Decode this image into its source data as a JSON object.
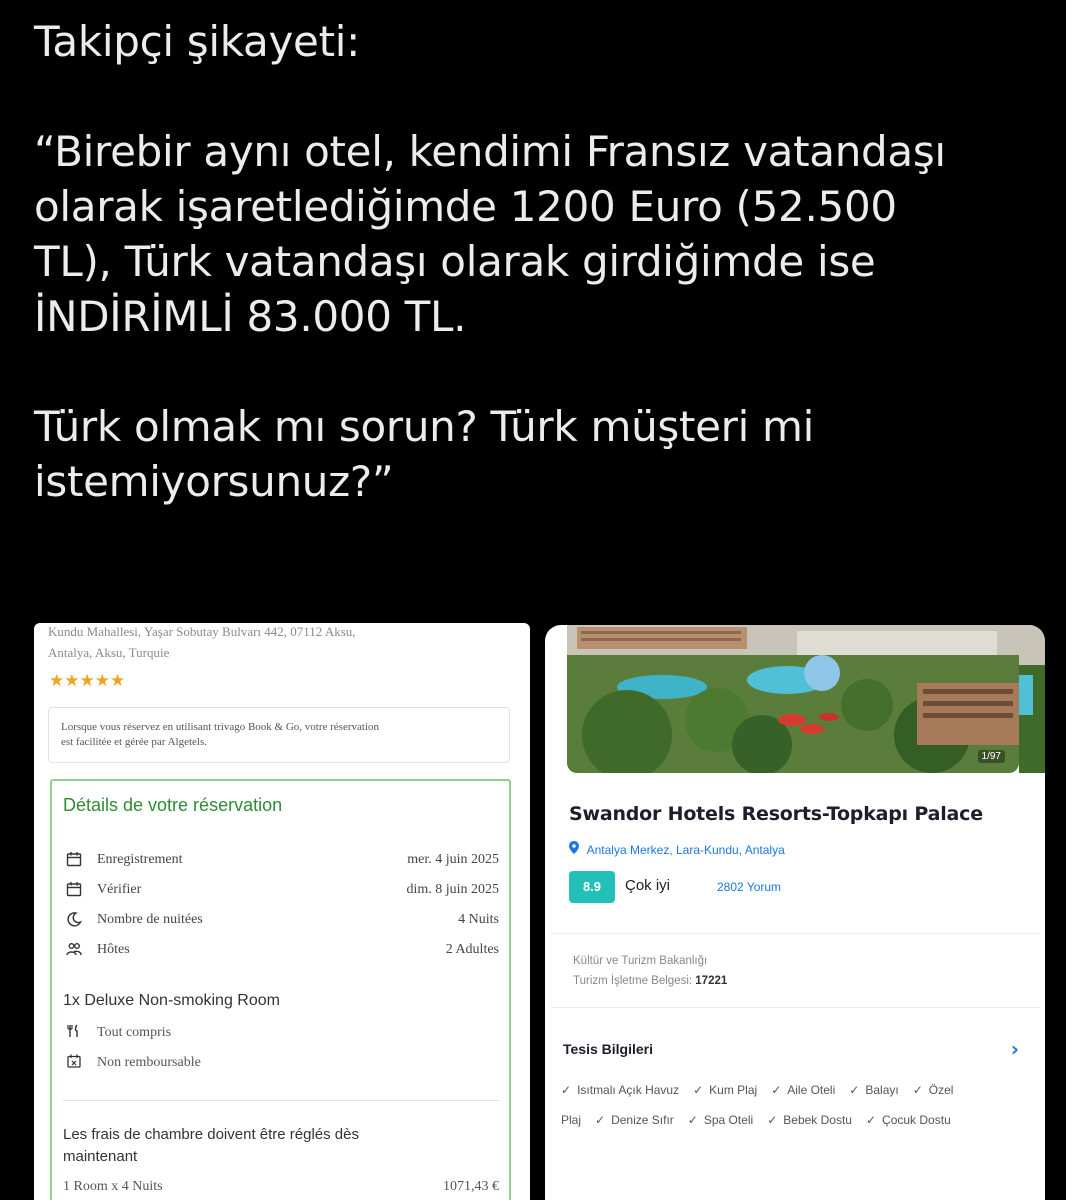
{
  "tweet": {
    "line_header": "Takipçi şikayeti:",
    "quote_lines": [
      "“Birebir aynı otel, kendimi Fransız vatandaşı",
      "olarak işaretlediğimde 1200 Euro (52.500",
      "TL), Türk vatandaşı olarak girdiğimde ise",
      "İNDİRİMLİ 83.000 TL."
    ],
    "question_lines": [
      "Türk olmak mı sorun? Türk müşteri mi",
      "istemiyorsunuz?”"
    ]
  },
  "trivago": {
    "address_line1": "Kundu Mahallesi, Yaşar Sobutay Bulvarı 442, 07112 Aksu,",
    "address_line2": "Antalya, Aksu, Turquie",
    "stars": "★★★★★",
    "notice_line1": "Lorsque vous réservez en utilisant trivago Book & Go, votre réservation",
    "notice_line2": "est facilitée et gérée par Algetels.",
    "details_title": "Détails de votre réservation",
    "rows": [
      {
        "label": "Enregistrement",
        "value": "mer. 4 juin 2025"
      },
      {
        "label": "Vérifier",
        "value": "dim. 8 juin 2025"
      },
      {
        "label": "Nombre de nuitées",
        "value": "4 Nuits"
      },
      {
        "label": "Hôtes",
        "value": "2 Adultes"
      }
    ],
    "room_title": "1x Deluxe Non-smoking Room",
    "board": "Tout compris",
    "refund": "Non remboursable",
    "fees_line1": "Les frais de chambre doivent être réglés dès",
    "fees_line2": "maintenant",
    "price_label": "1 Room x 4 Nuits",
    "price_value": "1071,43 €"
  },
  "turkish_site": {
    "photo_count": "1/97",
    "hotel_name": "Swandor Hotels Resorts-Topkapı Palace",
    "location": "Antalya Merkez, Lara-Kundu, Antalya",
    "score": "8.9",
    "score_label": "Çok iyi",
    "reviews": "2802 Yorum",
    "license_line1": "Kültür ve Turizm Bakanlığı",
    "license_prefix": "Turizm İşletme Belgesi:",
    "license_number": "17221",
    "facilities_title": "Tesis Bilgileri",
    "facilities_row1": [
      "Isıtmalı Açık Havuz",
      "Kum Plaj",
      "Aile Oteli",
      "Balayı",
      "Özel"
    ],
    "facilities_row2_first": "Plaj",
    "facilities_row2": [
      "Denize Sıfır",
      "Spa Oteli",
      "Bebek Dostu",
      "Çocuk Dostu"
    ]
  },
  "colors": {
    "background": "#000000",
    "green_accent": "#2f8b35",
    "score_teal": "#22c0b6",
    "link_blue": "#1a78e0",
    "star_orange": "#f0a222"
  }
}
